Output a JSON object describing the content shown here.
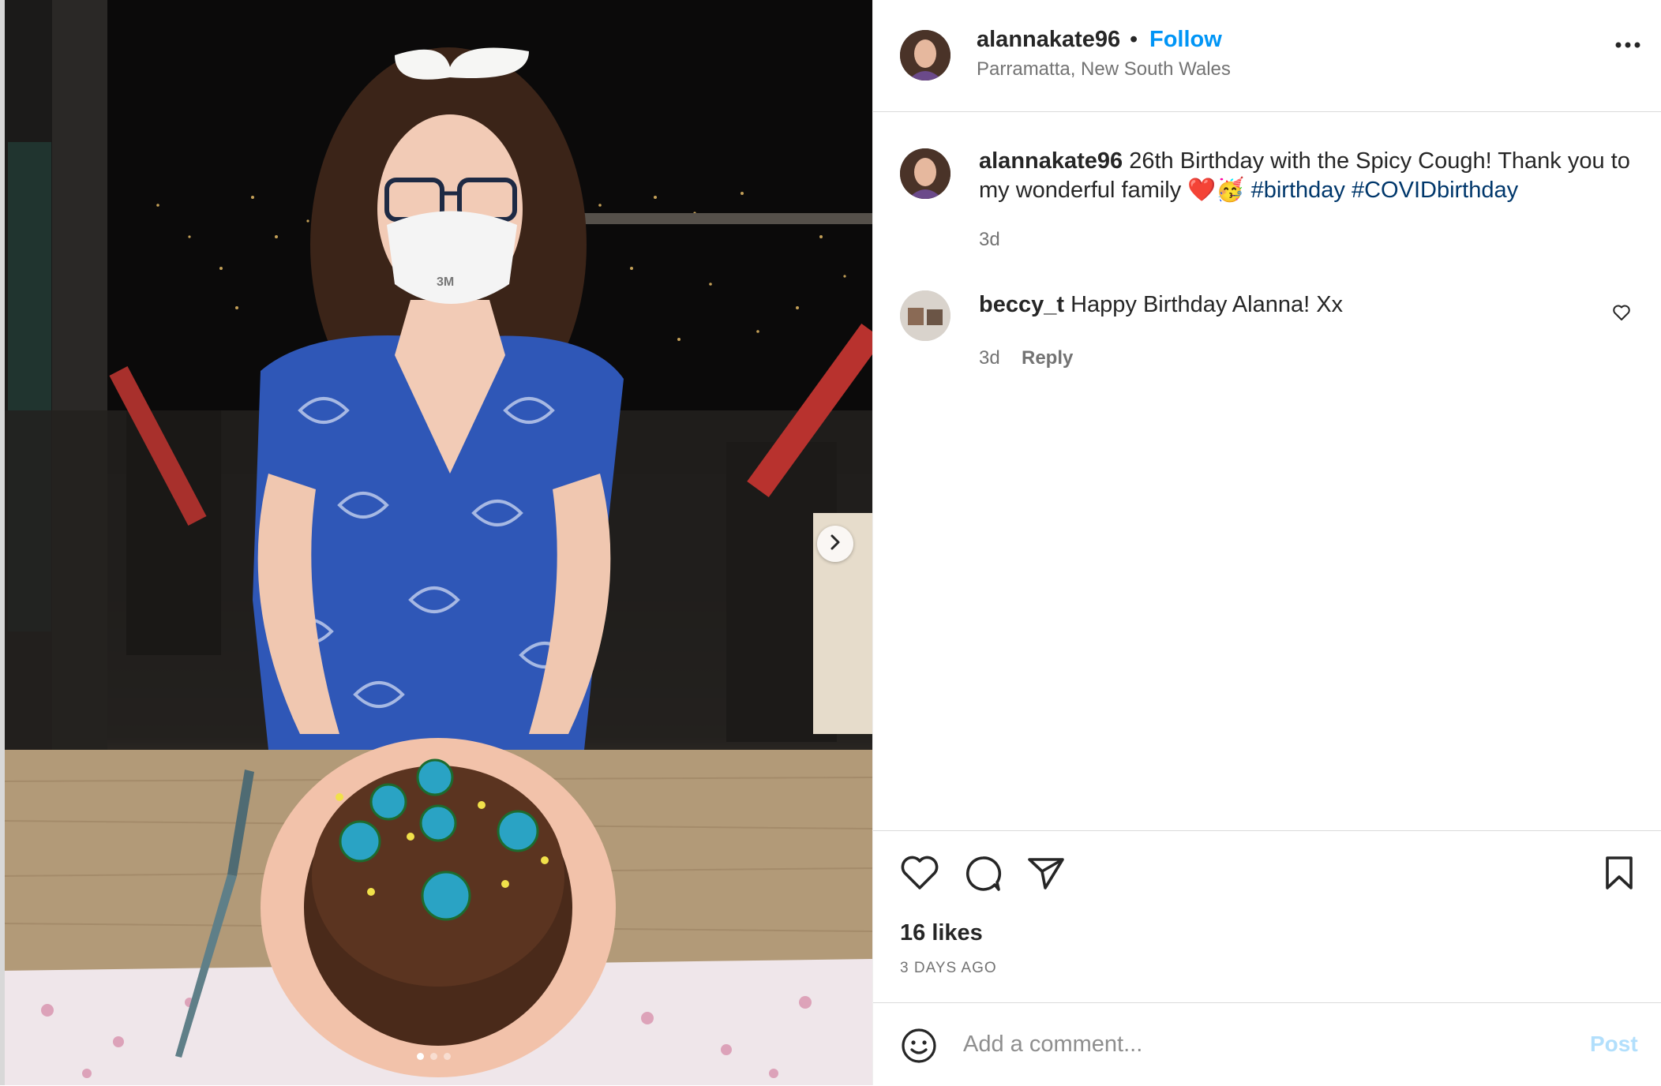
{
  "post": {
    "username": "alannakate96",
    "separator": "•",
    "follow_label": "Follow",
    "location": "Parramatta, New South Wales",
    "more_icon": "ellipsis-icon"
  },
  "caption": {
    "username": "alannakate96",
    "text": "26th Birthday with the Spicy Cough! Thank you to my wonderful family",
    "emoji": "❤️🥳",
    "hashtags": [
      "#birthday",
      "#COVIDbirthday"
    ],
    "time": "3d"
  },
  "comments": [
    {
      "username": "beccy_t",
      "text": "Happy Birthday Alanna! Xx",
      "time": "3d",
      "reply_label": "Reply"
    }
  ],
  "actions": {
    "icons": [
      "heart-icon",
      "comment-icon",
      "share-icon",
      "bookmark-icon"
    ],
    "likes": "16 likes",
    "posted": "3 DAYS AGO"
  },
  "comment_box": {
    "placeholder": "Add a comment...",
    "post_label": "Post",
    "emoji_icon": "smiley-icon"
  },
  "carousel": {
    "slides": 3,
    "current": 1
  }
}
